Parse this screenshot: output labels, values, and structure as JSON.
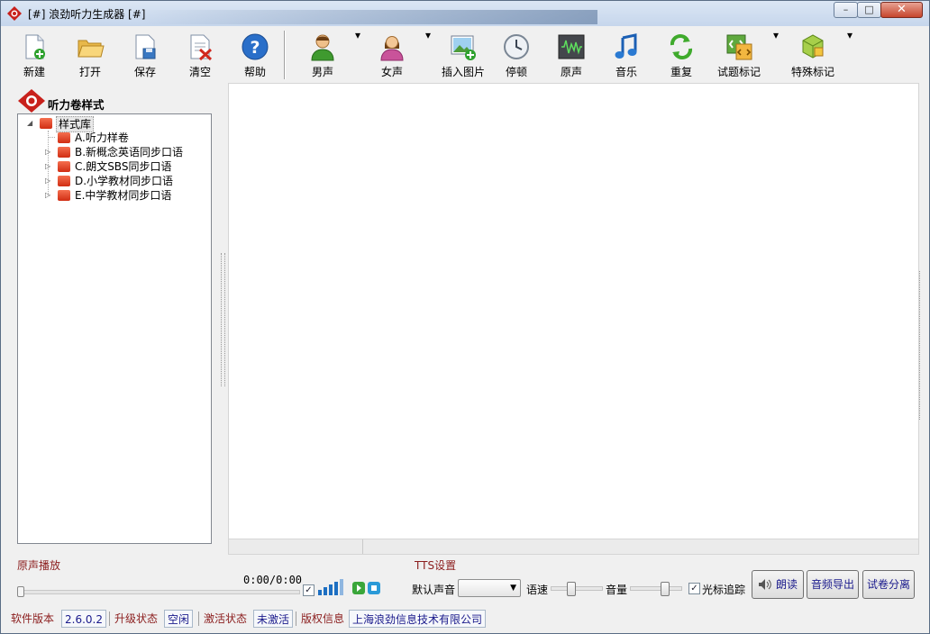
{
  "window": {
    "title": "[#] 浪劲听力生成器 [#]",
    "minimize_label": "–",
    "maximize_label": "□",
    "close_label": "✕"
  },
  "toolbar": {
    "items": [
      {
        "label": "新建",
        "icon": "new-file-icon"
      },
      {
        "label": "打开",
        "icon": "folder-open-icon"
      },
      {
        "label": "保存",
        "icon": "save-icon"
      },
      {
        "label": "清空",
        "icon": "clear-document-icon"
      },
      {
        "label": "帮助",
        "icon": "help-icon"
      },
      {
        "label": "男声",
        "icon": "male-voice-icon"
      },
      {
        "label": "女声",
        "icon": "female-voice-icon"
      },
      {
        "label": "插入图片",
        "icon": "insert-image-icon"
      },
      {
        "label": "停顿",
        "icon": "pause-clock-icon"
      },
      {
        "label": "原声",
        "icon": "waveform-icon"
      },
      {
        "label": "音乐",
        "icon": "music-note-icon"
      },
      {
        "label": "重复",
        "icon": "repeat-icon"
      },
      {
        "label": "试题标记",
        "icon": "question-mark-tag-icon"
      },
      {
        "label": "特殊标记",
        "icon": "special-mark-icon"
      }
    ],
    "dropdown_glyph": "▾"
  },
  "sidebar": {
    "title": "听力卷样式",
    "tree": {
      "root": "样式库",
      "children": [
        "A.听力样卷",
        "B.新概念英语同步口语",
        "C.朗文SBS同步口语",
        "D.小学教材同步口语",
        "E.中学教材同步口语"
      ]
    }
  },
  "playback": {
    "label": "原声播放",
    "time": "0:00/0:00",
    "checkbox_checked": "✓"
  },
  "tts": {
    "label": "TTS设置",
    "default_voice_label": "默认声音",
    "default_voice_value": "",
    "speed_label": "语速",
    "volume_label": "音量",
    "cursor_track_label": "光标追踪",
    "cursor_track_checked": "✓",
    "read_button": "朗读",
    "export_button": "音频导出",
    "split_button": "试卷分离"
  },
  "statusbar": {
    "version_label": "软件版本",
    "version_value": "2.6.0.2",
    "upgrade_label": "升级状态",
    "upgrade_value": "空闲",
    "activation_label": "激活状态",
    "activation_value": "未激活",
    "copyright_label": "版权信息",
    "copyright_value": "上海浪劲信息技术有限公司"
  },
  "colors": {
    "label_red": "#8b1d1d",
    "value_blue": "#1a1a8c",
    "accent": "#1d6fc2"
  }
}
